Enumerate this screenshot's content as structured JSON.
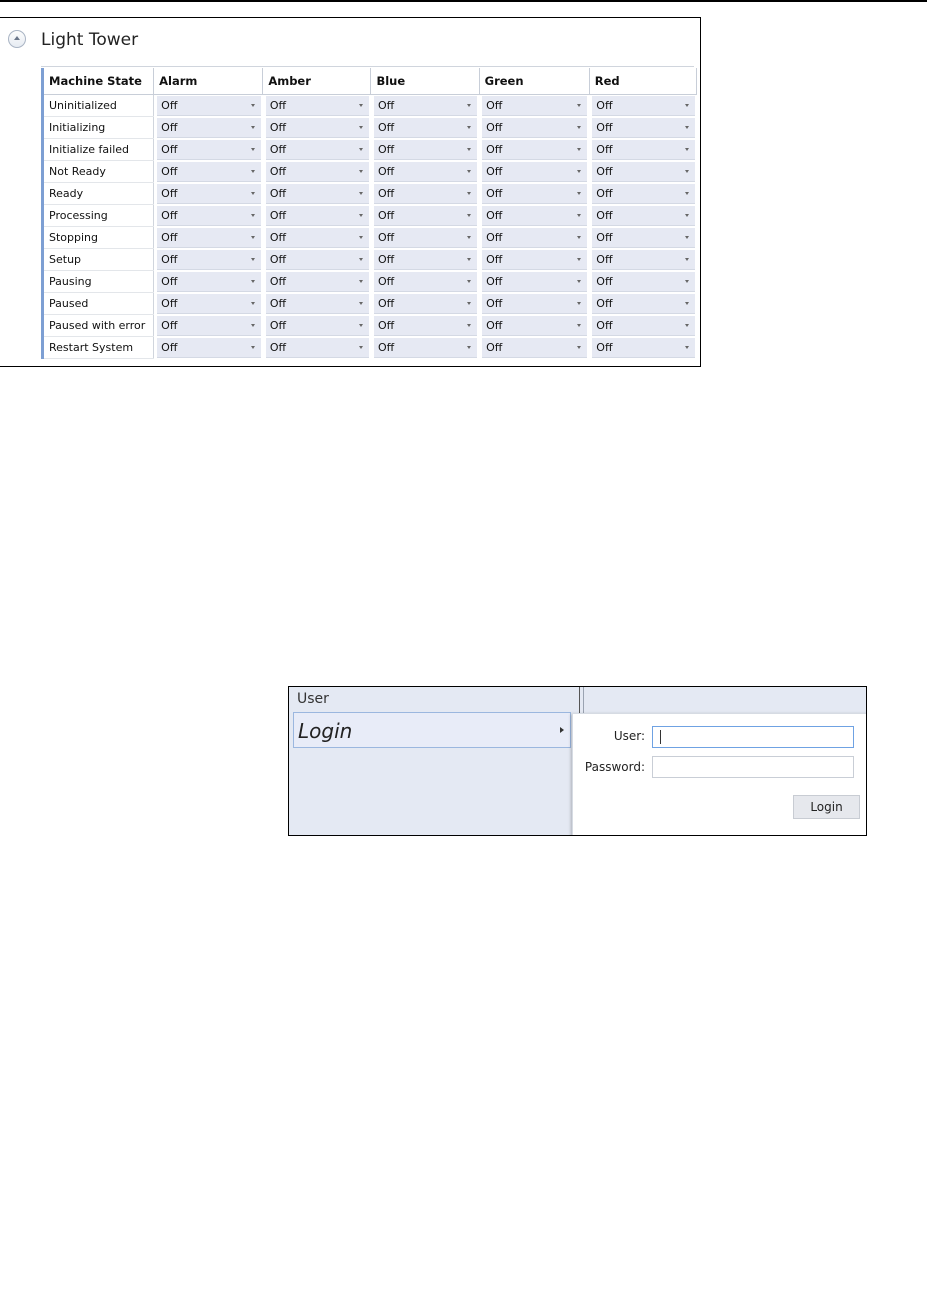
{
  "light_tower": {
    "title": "Light Tower",
    "columns": [
      "Machine State",
      "Alarm",
      "Amber",
      "Blue",
      "Green",
      "Red"
    ],
    "rows": [
      {
        "state": "Uninitialized",
        "values": [
          "Off",
          "Off",
          "Off",
          "Off",
          "Off"
        ]
      },
      {
        "state": "Initializing",
        "values": [
          "Off",
          "Off",
          "Off",
          "Off",
          "Off"
        ]
      },
      {
        "state": "Initialize failed",
        "values": [
          "Off",
          "Off",
          "Off",
          "Off",
          "Off"
        ]
      },
      {
        "state": "Not Ready",
        "values": [
          "Off",
          "Off",
          "Off",
          "Off",
          "Off"
        ]
      },
      {
        "state": "Ready",
        "values": [
          "Off",
          "Off",
          "Off",
          "Off",
          "Off"
        ]
      },
      {
        "state": "Processing",
        "values": [
          "Off",
          "Off",
          "Off",
          "Off",
          "Off"
        ]
      },
      {
        "state": "Stopping",
        "values": [
          "Off",
          "Off",
          "Off",
          "Off",
          "Off"
        ]
      },
      {
        "state": "Setup",
        "values": [
          "Off",
          "Off",
          "Off",
          "Off",
          "Off"
        ]
      },
      {
        "state": "Pausing",
        "values": [
          "Off",
          "Off",
          "Off",
          "Off",
          "Off"
        ]
      },
      {
        "state": "Paused",
        "values": [
          "Off",
          "Off",
          "Off",
          "Off",
          "Off"
        ]
      },
      {
        "state": "Paused with error",
        "values": [
          "Off",
          "Off",
          "Off",
          "Off",
          "Off"
        ]
      },
      {
        "state": "Restart System",
        "values": [
          "Off",
          "Off",
          "Off",
          "Off",
          "Off"
        ]
      }
    ]
  },
  "user_menu": {
    "header": "User",
    "item_label": "Login",
    "user_label": "User:",
    "user_value": "",
    "password_label": "Password:",
    "password_value": "",
    "login_button": "Login"
  },
  "colors": {
    "dropdown_bg": "#e6e9f3",
    "menu_bg": "#e4e9f3",
    "focus_border": "#6fa2e3",
    "grid_accent": "#7d9fd3"
  }
}
